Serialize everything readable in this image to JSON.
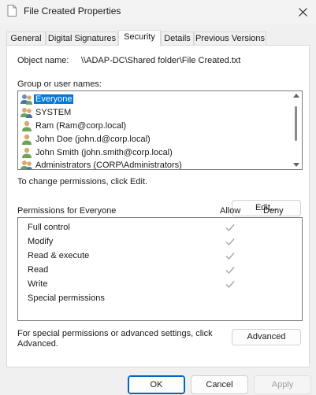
{
  "window": {
    "title": "File Created Properties",
    "icon": "document-icon"
  },
  "tabs": [
    {
      "label": "General",
      "active": false
    },
    {
      "label": "Digital Signatures",
      "active": false
    },
    {
      "label": "Security",
      "active": true
    },
    {
      "label": "Details",
      "active": false
    },
    {
      "label": "Previous Versions",
      "active": false
    }
  ],
  "security": {
    "object_name_label": "Object name:",
    "object_name_value": "\\\\ADAP-DC\\Shared folder\\File Created.txt",
    "group_label": "Group or user names:",
    "users": [
      {
        "name": "Everyone",
        "icon": "group-users-icon",
        "selected": true
      },
      {
        "name": "SYSTEM",
        "icon": "group-users-icon",
        "selected": false
      },
      {
        "name": "Ram (Ram@corp.local)",
        "icon": "user-icon",
        "selected": false
      },
      {
        "name": "John Doe (john.d@corp.local)",
        "icon": "user-icon",
        "selected": false
      },
      {
        "name": "John Smith (john.smith@corp.local)",
        "icon": "user-icon",
        "selected": false
      },
      {
        "name": "Administrators (CORP\\Administrators)",
        "icon": "group-users-icon",
        "selected": false
      }
    ],
    "change_text": "To change permissions, click Edit.",
    "edit_label": "Edit...",
    "permissions_header": "Permissions for Everyone",
    "allow_header": "Allow",
    "deny_header": "Deny",
    "permissions": [
      {
        "name": "Full control",
        "allow": true,
        "deny": false
      },
      {
        "name": "Modify",
        "allow": true,
        "deny": false
      },
      {
        "name": "Read & execute",
        "allow": true,
        "deny": false
      },
      {
        "name": "Read",
        "allow": true,
        "deny": false
      },
      {
        "name": "Write",
        "allow": true,
        "deny": false
      },
      {
        "name": "Special permissions",
        "allow": false,
        "deny": false
      }
    ],
    "special_text": "For special permissions or advanced settings, click Advanced.",
    "advanced_label": "Advanced"
  },
  "footer": {
    "ok_label": "OK",
    "cancel_label": "Cancel",
    "apply_label": "Apply"
  },
  "colors": {
    "selection": "#0078d7",
    "check_disabled": "#a6a6a6",
    "ok_border": "#0067c0"
  }
}
